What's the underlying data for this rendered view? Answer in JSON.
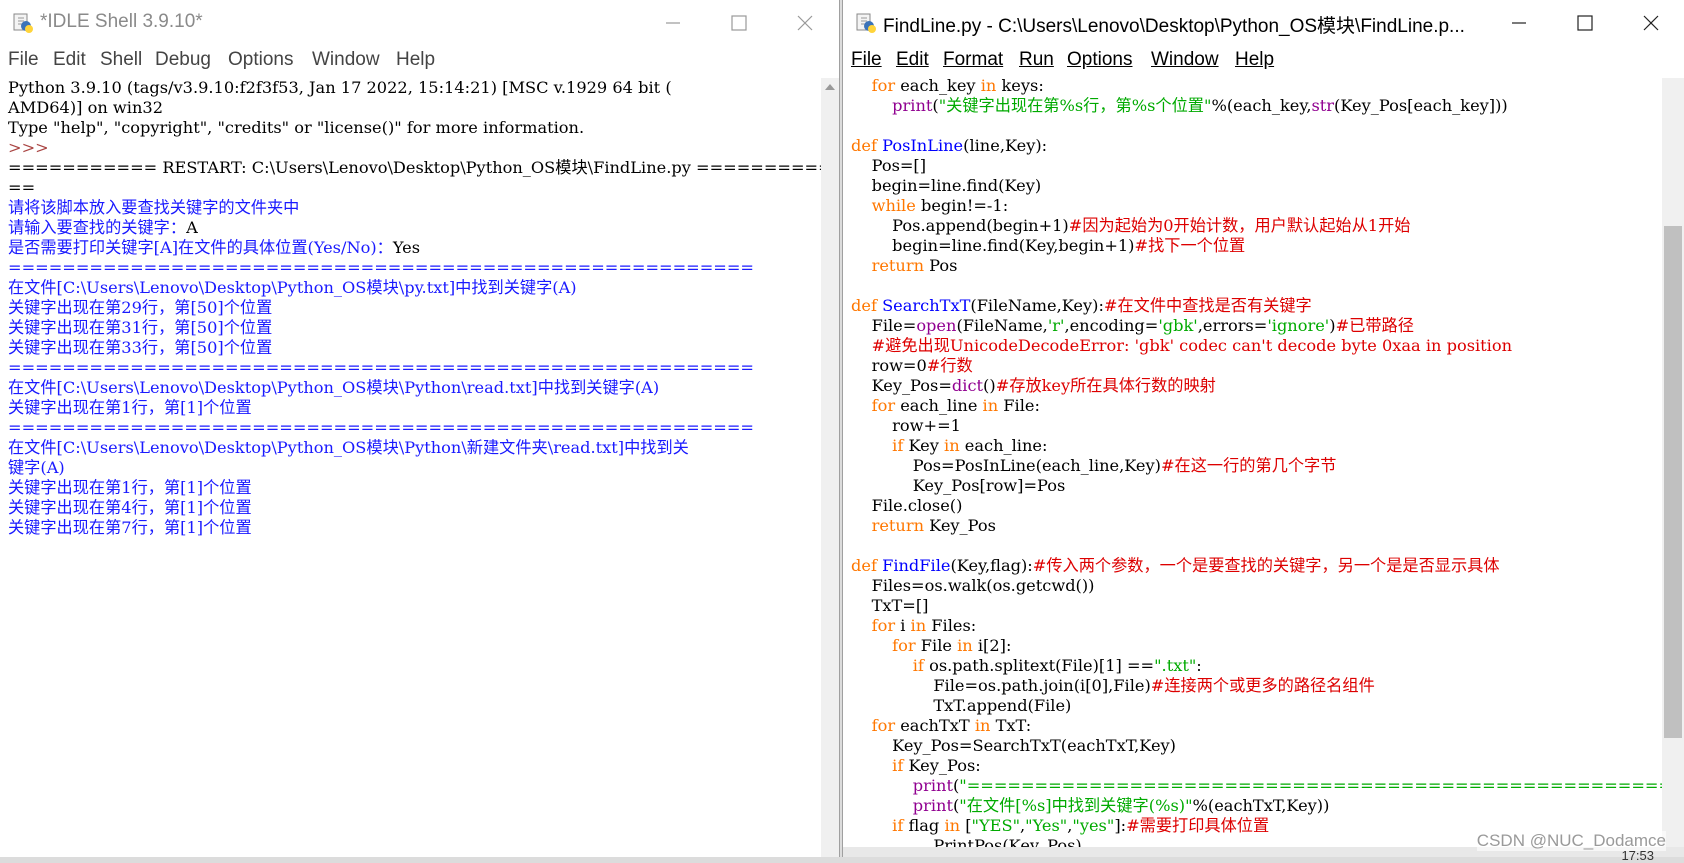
{
  "left_window": {
    "title": "*IDLE Shell 3.9.10*",
    "menu": [
      "File",
      "Edit",
      "Shell",
      "Debug",
      "Options",
      "Window",
      "Help"
    ],
    "lines": [
      {
        "cls": "c-out",
        "text": "Python 3.9.10 (tags/v3.9.10:f2f3f53, Jan 17 2022, 15:14:21) [MSC v.1929 64 bit ("
      },
      {
        "cls": "c-out",
        "text": "AMD64)] on win32"
      },
      {
        "cls": "c-out",
        "text": "Type \"help\", \"copyright\", \"credits\" or \"license()\" for more information."
      },
      {
        "cls": "c-prompt",
        "text": ">>>"
      },
      {
        "cls": "c-out",
        "text": "=========== RESTART: C:\\Users\\Lenovo\\Desktop\\Python_OS模块\\FindLine.py =========="
      },
      {
        "cls": "c-out",
        "text": "=="
      },
      {
        "cls": "c-blue",
        "text": "请将该脚本放入要查找关键字的文件夹中"
      },
      {
        "cls": "c-blue",
        "text": "请输入要查找的关键字：",
        "tail": "A"
      },
      {
        "cls": "c-blue",
        "text": "是否需要打印关键字[A]在文件的具体位置(Yes/No)：",
        "tail": "Yes"
      },
      {
        "cls": "c-blue",
        "text": "======================================================="
      },
      {
        "cls": "c-blue",
        "text": "在文件[C:\\Users\\Lenovo\\Desktop\\Python_OS模块\\py.txt]中找到关键字(A)"
      },
      {
        "cls": "c-blue",
        "text": "关键字出现在第29行，第[50]个位置"
      },
      {
        "cls": "c-blue",
        "text": "关键字出现在第31行，第[50]个位置"
      },
      {
        "cls": "c-blue",
        "text": "关键字出现在第33行，第[50]个位置"
      },
      {
        "cls": "c-blue",
        "text": "======================================================="
      },
      {
        "cls": "c-blue",
        "text": "在文件[C:\\Users\\Lenovo\\Desktop\\Python_OS模块\\Python\\read.txt]中找到关键字(A)"
      },
      {
        "cls": "c-blue",
        "text": "关键字出现在第1行，第[1]个位置"
      },
      {
        "cls": "c-blue",
        "text": "======================================================="
      },
      {
        "cls": "c-blue",
        "text": "在文件[C:\\Users\\Lenovo\\Desktop\\Python_OS模块\\Python\\新建文件夹\\read.txt]中找到关"
      },
      {
        "cls": "c-blue",
        "text": "键字(A)"
      },
      {
        "cls": "c-blue",
        "text": "关键字出现在第1行，第[1]个位置"
      },
      {
        "cls": "c-blue",
        "text": "关键字出现在第4行，第[1]个位置"
      },
      {
        "cls": "c-blue",
        "text": "关键字出现在第7行，第[1]个位置"
      }
    ]
  },
  "right_window": {
    "title": "FindLine.py - C:\\Users\\Lenovo\\Desktop\\Python_OS模块\\FindLine.p...",
    "menu": [
      "File",
      "Edit",
      "Format",
      "Run",
      "Options",
      "Window",
      "Help"
    ],
    "lines": [
      [
        [
          "    ",
          "c-out"
        ],
        [
          "for",
          "c-kw"
        ],
        [
          " each_key ",
          "c-out"
        ],
        [
          "in",
          "c-kw"
        ],
        [
          " keys:",
          "c-out"
        ]
      ],
      [
        [
          "        ",
          "c-out"
        ],
        [
          "print",
          "c-bi"
        ],
        [
          "(",
          "c-out"
        ],
        [
          "\"关键字出现在第%s行，第%s个位置\"",
          "c-str"
        ],
        [
          "%(each_key,",
          "c-out"
        ],
        [
          "str",
          "c-bi"
        ],
        [
          "(Key_Pos[each_key]))",
          "c-out"
        ]
      ],
      [
        [
          "",
          "c-out"
        ]
      ],
      [
        [
          "def",
          "c-kw"
        ],
        [
          " ",
          "c-out"
        ],
        [
          "PosInLine",
          "c-def"
        ],
        [
          "(line,Key):",
          "c-out"
        ]
      ],
      [
        [
          "    Pos=[]",
          "c-out"
        ]
      ],
      [
        [
          "    begin=line.find(Key)",
          "c-out"
        ]
      ],
      [
        [
          "    ",
          "c-out"
        ],
        [
          "while",
          "c-kw"
        ],
        [
          " begin!=-1:",
          "c-out"
        ]
      ],
      [
        [
          "        Pos.append(begin+1)",
          "c-out"
        ],
        [
          "#因为起始为0开始计数，用户默认起始从1开始",
          "c-cm"
        ]
      ],
      [
        [
          "        begin=line.find(Key,begin+1)",
          "c-out"
        ],
        [
          "#找下一个位置",
          "c-cm"
        ]
      ],
      [
        [
          "    ",
          "c-out"
        ],
        [
          "return",
          "c-kw"
        ],
        [
          " Pos",
          "c-out"
        ]
      ],
      [
        [
          "",
          "c-out"
        ]
      ],
      [
        [
          "def",
          "c-kw"
        ],
        [
          " ",
          "c-out"
        ],
        [
          "SearchTxT",
          "c-def"
        ],
        [
          "(FileName,Key):",
          "c-out"
        ],
        [
          "#在文件中查找是否有关键字",
          "c-cm"
        ]
      ],
      [
        [
          "    File=",
          "c-out"
        ],
        [
          "open",
          "c-bi"
        ],
        [
          "(FileName,",
          "c-out"
        ],
        [
          "'r'",
          "c-str"
        ],
        [
          ",encoding=",
          "c-out"
        ],
        [
          "'gbk'",
          "c-str"
        ],
        [
          ",errors=",
          "c-out"
        ],
        [
          "'ignore'",
          "c-str"
        ],
        [
          ")",
          "c-out"
        ],
        [
          "#已带路径",
          "c-cm"
        ]
      ],
      [
        [
          "    ",
          "c-out"
        ],
        [
          "#避免出现UnicodeDecodeError: 'gbk' codec can't decode byte 0xaa in position",
          "c-cm"
        ]
      ],
      [
        [
          "    row=0",
          "c-out"
        ],
        [
          "#行数",
          "c-cm"
        ]
      ],
      [
        [
          "    Key_Pos=",
          "c-out"
        ],
        [
          "dict",
          "c-bi"
        ],
        [
          "()",
          "c-out"
        ],
        [
          "#存放key所在具体行数的映射",
          "c-cm"
        ]
      ],
      [
        [
          "    ",
          "c-out"
        ],
        [
          "for",
          "c-kw"
        ],
        [
          " each_line ",
          "c-out"
        ],
        [
          "in",
          "c-kw"
        ],
        [
          " File:",
          "c-out"
        ]
      ],
      [
        [
          "        row+=1",
          "c-out"
        ]
      ],
      [
        [
          "        ",
          "c-out"
        ],
        [
          "if",
          "c-kw"
        ],
        [
          " Key ",
          "c-out"
        ],
        [
          "in",
          "c-kw"
        ],
        [
          " each_line:",
          "c-out"
        ]
      ],
      [
        [
          "            Pos=PosInLine(each_line,Key)",
          "c-out"
        ],
        [
          "#在这一行的第几个字节",
          "c-cm"
        ]
      ],
      [
        [
          "            Key_Pos[row]=Pos",
          "c-out"
        ]
      ],
      [
        [
          "    File.close()",
          "c-out"
        ]
      ],
      [
        [
          "    ",
          "c-out"
        ],
        [
          "return",
          "c-kw"
        ],
        [
          " Key_Pos",
          "c-out"
        ]
      ],
      [
        [
          "",
          "c-out"
        ]
      ],
      [
        [
          "def",
          "c-kw"
        ],
        [
          " ",
          "c-out"
        ],
        [
          "FindFile",
          "c-def"
        ],
        [
          "(Key,flag):",
          "c-out"
        ],
        [
          "#传入两个参数，一个是要查找的关键字，另一个是是否显示具体",
          "c-cm"
        ]
      ],
      [
        [
          "    Files=os.walk(os.getcwd())",
          "c-out"
        ]
      ],
      [
        [
          "    TxT=[]",
          "c-out"
        ]
      ],
      [
        [
          "    ",
          "c-out"
        ],
        [
          "for",
          "c-kw"
        ],
        [
          " i ",
          "c-out"
        ],
        [
          "in",
          "c-kw"
        ],
        [
          " Files:",
          "c-out"
        ]
      ],
      [
        [
          "        ",
          "c-out"
        ],
        [
          "for",
          "c-kw"
        ],
        [
          " File ",
          "c-out"
        ],
        [
          "in",
          "c-kw"
        ],
        [
          " i[2]:",
          "c-out"
        ]
      ],
      [
        [
          "            ",
          "c-out"
        ],
        [
          "if",
          "c-kw"
        ],
        [
          " os.path.splitext(File)[1] ==",
          "c-out"
        ],
        [
          "\".txt\"",
          "c-str"
        ],
        [
          ":",
          "c-out"
        ]
      ],
      [
        [
          "                File=os.path.join(i[0],File)",
          "c-out"
        ],
        [
          "#连接两个或更多的路径名组件",
          "c-cm"
        ]
      ],
      [
        [
          "                TxT.append(File)",
          "c-out"
        ]
      ],
      [
        [
          "    ",
          "c-out"
        ],
        [
          "for",
          "c-kw"
        ],
        [
          " eachTxT ",
          "c-out"
        ],
        [
          "in",
          "c-kw"
        ],
        [
          " TxT:",
          "c-out"
        ]
      ],
      [
        [
          "        Key_Pos=SearchTxT(eachTxT,Key)",
          "c-out"
        ]
      ],
      [
        [
          "        ",
          "c-out"
        ],
        [
          "if",
          "c-kw"
        ],
        [
          " Key_Pos:",
          "c-out"
        ]
      ],
      [
        [
          "            ",
          "c-out"
        ],
        [
          "print",
          "c-bi"
        ],
        [
          "(",
          "c-out"
        ],
        [
          "\"=======================================================\"",
          "c-str"
        ],
        [
          ")",
          "c-out"
        ]
      ],
      [
        [
          "            ",
          "c-out"
        ],
        [
          "print",
          "c-bi"
        ],
        [
          "(",
          "c-out"
        ],
        [
          "\"在文件[%s]中找到关键字(%s)\"",
          "c-str"
        ],
        [
          "%(eachTxT,Key))",
          "c-out"
        ]
      ],
      [
        [
          "        ",
          "c-out"
        ],
        [
          "if",
          "c-kw"
        ],
        [
          " flag ",
          "c-out"
        ],
        [
          "in",
          "c-kw"
        ],
        [
          " [",
          "c-out"
        ],
        [
          "\"YES\"",
          "c-str"
        ],
        [
          ",",
          "c-out"
        ],
        [
          "\"Yes\"",
          "c-str"
        ],
        [
          ",",
          "c-out"
        ],
        [
          "\"yes\"",
          "c-str"
        ],
        [
          "]:",
          "c-out"
        ],
        [
          "#需要打印具体位置",
          "c-cm"
        ]
      ],
      [
        [
          "                PrintPos(Key_Pos)",
          "c-out"
        ]
      ]
    ]
  },
  "watermark": "CSDN @NUC_Dodamce",
  "corner_time": "17:53"
}
